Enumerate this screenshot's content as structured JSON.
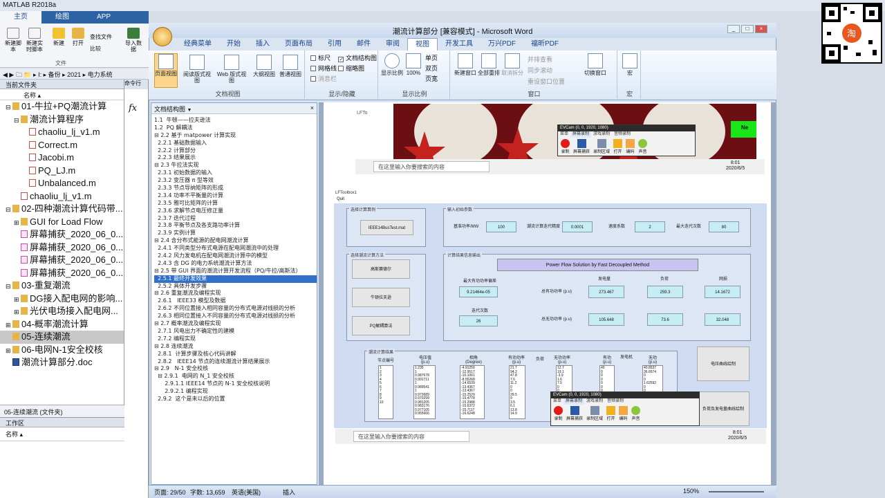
{
  "matlab": {
    "title": "MATLAB R2018a",
    "tabs": [
      "主页",
      "绘图",
      "APP"
    ],
    "ribbon_buttons": [
      "新建脚本",
      "新建实时脚本",
      "新建",
      "打开",
      "查找文件",
      "比较",
      "导入数据"
    ],
    "file_group": "文件",
    "path": "◀ ▶ 🗀 📁 ▸ I: ▸ 备份 ▸ 2021 ▸ 电力系统",
    "current_folder_header": "当前文件夹",
    "name_col": "名称 ▴",
    "command_window": "命令行",
    "files": [
      {
        "label": "01-牛拉+PQ潮流计算",
        "indent": 0,
        "type": "folder",
        "expand": "⊟"
      },
      {
        "label": "潮流计算程序",
        "indent": 1,
        "type": "folder",
        "expand": "⊟"
      },
      {
        "label": "chaoliu_lj_v1.m",
        "indent": 2,
        "type": "m"
      },
      {
        "label": "Correct.m",
        "indent": 2,
        "type": "m"
      },
      {
        "label": "Jacobi.m",
        "indent": 2,
        "type": "m"
      },
      {
        "label": "PQ_LJ.m",
        "indent": 2,
        "type": "m"
      },
      {
        "label": "Unbalanced.m",
        "indent": 2,
        "type": "m"
      },
      {
        "label": "chaoliu_lj_v1.m",
        "indent": 1,
        "type": "m"
      },
      {
        "label": "02-四种潮流计算代码带...",
        "indent": 0,
        "type": "folder",
        "expand": "⊟"
      },
      {
        "label": "GUI for Load Flow",
        "indent": 1,
        "type": "folder",
        "expand": "⊞"
      },
      {
        "label": "屏幕捕获_2020_06_0...",
        "indent": 1,
        "type": "img"
      },
      {
        "label": "屏幕捕获_2020_06_0...",
        "indent": 1,
        "type": "img"
      },
      {
        "label": "屏幕捕获_2020_06_0...",
        "indent": 1,
        "type": "img"
      },
      {
        "label": "屏幕捕获_2020_06_0...",
        "indent": 1,
        "type": "img"
      },
      {
        "label": "03-重复潮流",
        "indent": 0,
        "type": "folder",
        "expand": "⊟"
      },
      {
        "label": "DG接入配电网的影响...",
        "indent": 1,
        "type": "folder",
        "expand": "⊞"
      },
      {
        "label": "光伏电场接入配电网...",
        "indent": 1,
        "type": "folder",
        "expand": "⊞"
      },
      {
        "label": "04-概率潮流计算",
        "indent": 0,
        "type": "folder",
        "expand": "⊞"
      },
      {
        "label": "05-连续潮流",
        "indent": 0,
        "type": "folder",
        "expand": "",
        "selected": true
      },
      {
        "label": "06-电网N-1安全校核",
        "indent": 0,
        "type": "folder",
        "expand": "⊞"
      },
      {
        "label": "潮流计算部分.doc",
        "indent": 0,
        "type": "doc"
      }
    ],
    "details": "05-连续潮流 (文件夹)",
    "workspace": "工作区",
    "ws_name": "名称 ▴"
  },
  "word": {
    "title": "潮流计算部分 [兼容模式] - Microsoft Word",
    "tabs": [
      "经典菜单",
      "开始",
      "插入",
      "页面布局",
      "引用",
      "邮件",
      "审阅",
      "视图",
      "开发工具",
      "万兴PDF",
      "福昕PDF"
    ],
    "active_tab": "视图",
    "views": [
      "页面视图",
      "阅读版式视图",
      "Web 版式视图",
      "大纲视图",
      "普通视图"
    ],
    "g1": "文档视图",
    "checks": [
      "标尺",
      "网格线",
      "消息栏",
      "文档结构图",
      "缩略图"
    ],
    "g2": "显示/隐藏",
    "zoom": [
      "显示比例",
      "100%",
      "单页",
      "双页",
      "页宽"
    ],
    "g3": "显示比例",
    "win": [
      "新建窗口",
      "全部重排",
      "取消拆分",
      "并排查看",
      "同步滚动",
      "重设窗口位置",
      "切换窗口"
    ],
    "g4": "窗口",
    "macro": "宏",
    "g5": "宏",
    "docmap": "文档结构图",
    "outline": [
      "1.1  牛顿——拉夫逊法",
      "1.2  PQ 解耦法",
      "⊟ 2.2 基于 matpower 计算实现",
      "  2.2.1 基础数据输入",
      "  2.2.2 计算部分",
      "  2.2.3 结果展示",
      "⊟ 2.3 牛拉法实现",
      "  2.3.1 初始数据的输入",
      "  2.3.2 变压器 π 型等效",
      "  2.3.3 节点导纳矩阵的形成",
      "  2.3.4 功率不平衡量的计算",
      "  2.3.5 雅可比矩阵的计算",
      "  2.3.6 求解节点电压修正量",
      "  2.3.7 迭代过程",
      "  2.3.8 平衡节点及各支路功率计算",
      "  2.3.9 实例计算",
      "⊟ 2.4 含分布式能源的配电网潮流计算",
      "  2.4.1 不同类型分布式电源在配电网潮流中的处理",
      "  2.4.2 风力发电机在配电网潮流计算中的模型",
      "  2.4.3 含 DG 的电力系统潮流计算方法",
      "⊟ 2.5 带 GUI 界面的潮流计算开发流程（PQ/牛拉/高斯法）",
      "  2.5.1 最终开发效果",
      "  2.5.2 具体开发步骤",
      "⊟ 2.6 重复潮流及编程实现",
      "  2.6.1   IEEE33 模型及数据",
      "  2.6.2 不同位置接入相同容量的分布式电源对线损的分析",
      "  2.6.3 相同位置接入不同容量的分布式电源对线损的分析",
      "⊟ 2.7 概率潮流及编程实现",
      "  2.7.1 风电出力不确定性的建模",
      "  2.7.2 编程实现",
      "⊟ 2.8 连续潮流",
      "  2.8.1  计算步骤及核心代码讲解",
      "  2.8.2   IEEE14 节点的连续潮流计算结果展示",
      "⊟ 2.9   N-1 安全校核",
      "  ⊟ 2.9.1  电网的 N_1 安全校核",
      "      2.9.1.1 IEEE14 节点的 N-1 安全校核说明",
      "      2.9.2.1 编程实现",
      "  2.9.2  这个是未以后的位置"
    ],
    "highlight": 21,
    "status": [
      "页面: 29/50",
      "字数: 13,659",
      "英语(美国)",
      "插入"
    ],
    "zoom_pct": "150%"
  },
  "shot": {
    "search": "在这里输入你要搜索的内容",
    "time": "8:01",
    "date": "2020/6/5",
    "ev_title": "EVCam (0, 0, 1920, 1080)",
    "ev_menu": [
      "菜单",
      "屏幕录制",
      "游戏录制",
      "音频录制"
    ],
    "ev_btns": [
      "录制",
      "屏幕捕获",
      "录制区域",
      "打开",
      "编码",
      "声音"
    ],
    "ne": "Ne"
  },
  "lf": {
    "title": "LFToolbox1",
    "menu": "Quit",
    "g_case": "选择计算算例",
    "case_btn": "IEEE14BusTest.mat",
    "g_param": "输入初始参数",
    "p_labels": [
      "基准功率/MW",
      "潮流计算迭代精度",
      "速度系数",
      "最大迭代次数"
    ],
    "p_values": [
      "100",
      "0.0001",
      "2",
      "80"
    ],
    "g_method": "选择潮流计算方法",
    "methods": [
      "高斯赛德尔",
      "牛顿拉夫逊",
      "PQ解耦算法"
    ],
    "g_out": "计算结果信息输出",
    "out_title": "Power Flow Solution by Fast Decoupled Method",
    "out_cols": [
      "发电量",
      "负荷",
      "网损"
    ],
    "conv_label": "最大有功功率偏差",
    "conv": "9.21464e-05",
    "iter_label": "迭代次数",
    "iter": "26",
    "p_label": "总有功功率 (p.u)",
    "q_label": "总无功功率 (p.u)",
    "p_vals": [
      "273.467",
      "259.3",
      "14.1672"
    ],
    "q_vals": [
      "105.648",
      "73.6",
      "32.048"
    ],
    "g_table": "潮流计算结果",
    "tcols": [
      "节点编号",
      "电压值 (p.u)",
      "相角 (Degree)",
      "有功功率 (p.u)",
      "负荷",
      "无功功率 (p.u)",
      "有功 (p.u)",
      "发电机",
      "无功 (p.u)"
    ],
    "col_node": "1\n2\n3\n4\n5\n6\n7\n8\n9\n10",
    "col_v": "1.235\n1\n0.987678\n0.991711\n1\n0.989541\n1\n0.973689\n0.970299\n0.981205\n0.983176\n0.977105\n0.955666",
    "col_a": "-4.91256\n-12.9517\n-10.1061\n-8.55268\n-14.6539\n-13.4367\n-13.4367\n-15.2529\n-15.4778\n-15.2988\n-15.6372\n-15.7117\n-16.6248",
    "col_p": "21.7\n94.2\n47.8\n7.6\n11.2\n0\n0\n29.5\n9\n3.5\n6.1\n13.8\n14.9",
    "col_q": "12.7\n19.1\n-3.9\n1.6\n7.5\n0\n0\n16.6\n5.8\n1.8\n1.6\n5.8\n5",
    "col_g": "40\n0\n0\n0\n0\n0\n0\n0\n0\n0",
    "col_gq": "40.8537\n36.6574\n0\n0\n1.62592\n0\n0\n0",
    "btn_v": "电压曲线绘制",
    "btn_pv": "负荷及发电量曲线绘制"
  }
}
